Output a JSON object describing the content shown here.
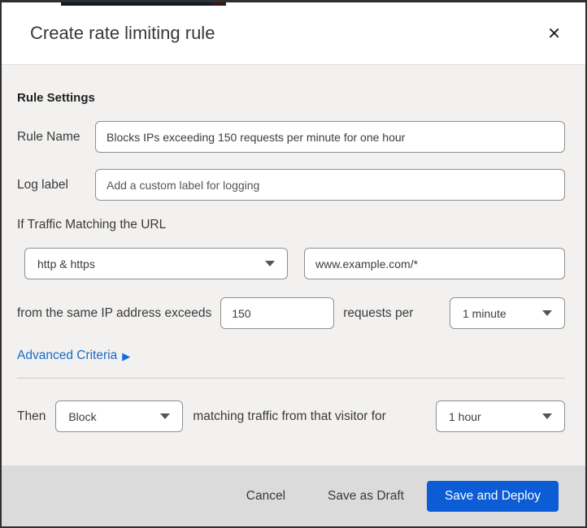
{
  "colors": {
    "primary_button_blue": "#0b5cd5",
    "link_blue": "#1a6bc6",
    "body_background": "#f2f1f0",
    "footer_background": "#dbdbdb",
    "frame_border": "#2f2f2f"
  },
  "dialog": {
    "title": "Create rate limiting rule",
    "close_icon": "✕"
  },
  "rule_settings": {
    "heading": "Rule Settings",
    "rule_name": {
      "label": "Rule Name",
      "value": "Blocks IPs exceeding 150 requests per minute for one hour"
    },
    "log_label": {
      "label": "Log label",
      "placeholder": "Add a custom label for logging"
    }
  },
  "match": {
    "intro": "If Traffic Matching the URL",
    "scheme_select_value": "http & https",
    "url_value": "www.example.com/*",
    "threshold_prefix": "from the same IP address exceeds",
    "count_value": "150",
    "threshold_middle": "requests per",
    "period_select_value": "1 minute",
    "advanced_label": "Advanced Criteria",
    "advanced_arrow": "▶"
  },
  "action": {
    "then_label": "Then",
    "action_select_value": "Block",
    "middle_text": "matching traffic from that visitor for",
    "duration_select_value": "1 hour"
  },
  "footer": {
    "cancel_label": "Cancel",
    "save_draft_label": "Save as Draft",
    "save_deploy_label": "Save and Deploy"
  }
}
